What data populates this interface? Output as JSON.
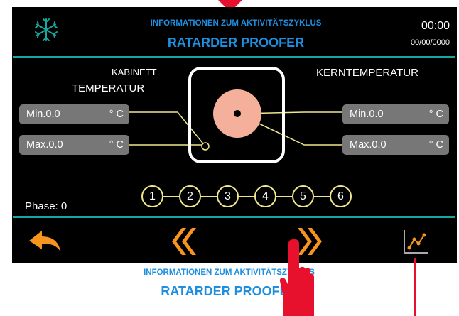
{
  "header": {
    "subtitle": "INFORMATIONEN ZUM AKTIVITÄTSZYKLUS",
    "title": "RATARDER PROOFER",
    "time": "00:00",
    "date": "00/00/0000",
    "mode_icon": "snowflake-icon"
  },
  "cabinet": {
    "label_top": "KABINETT",
    "label_bottom": "TEMPERATUR",
    "min": {
      "label": "Min.0.0",
      "unit": "° C"
    },
    "max": {
      "label": "Max.0.0",
      "unit": "° C"
    }
  },
  "core": {
    "label": "KERNTEMPERATUR",
    "min": {
      "label": "Min.0.0",
      "unit": "° C"
    },
    "max": {
      "label": "Max.0.0",
      "unit": "° C"
    }
  },
  "phase": {
    "label": "Phase: 0"
  },
  "steps": [
    "1",
    "2",
    "3",
    "4",
    "5",
    "6"
  ],
  "footer": {
    "back_icon": "back-arrow-icon",
    "prev_icon": "double-chevron-left-icon",
    "next_icon": "double-chevron-right-icon",
    "chart_icon": "chart-icon"
  },
  "caption": {
    "subtitle": "INFORMATIONEN ZUM AKTIVITÄTSZYKLUS",
    "title": "RATARDER PROOFER"
  },
  "colors": {
    "accent_blue": "#1e8fe0",
    "teal_rule": "#16a8a0",
    "orange": "#f7941d",
    "yellow_line": "#f0e68c",
    "field_gray": "#777777",
    "core_pink": "#f4b09a",
    "annotation_red": "#e8112d"
  }
}
